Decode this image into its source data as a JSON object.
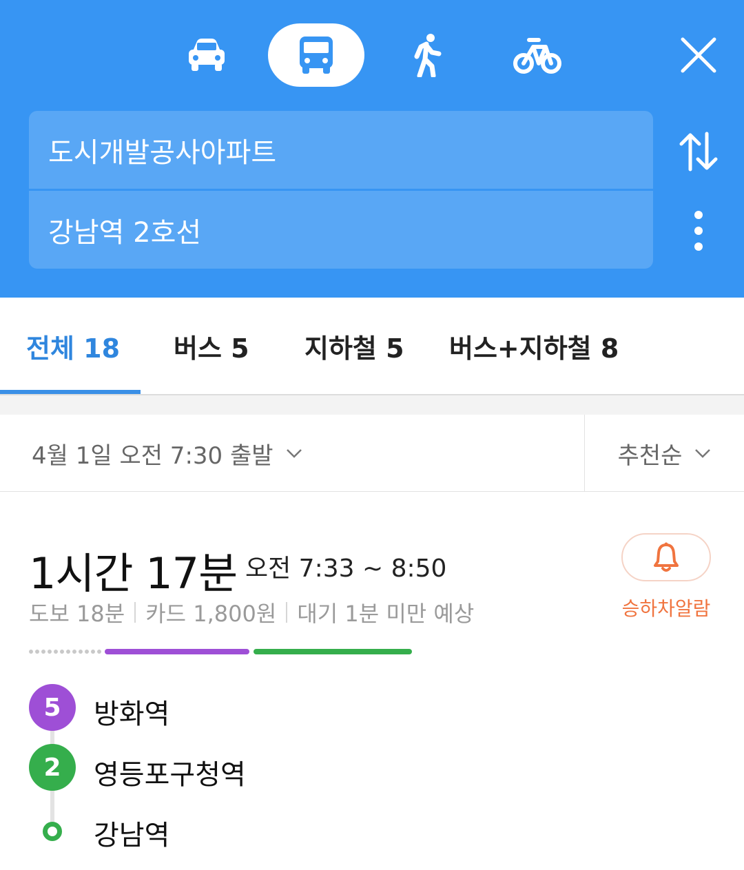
{
  "header": {
    "modes": [
      {
        "name": "car",
        "icon": "car-icon",
        "selected": false
      },
      {
        "name": "transit",
        "icon": "bus-icon",
        "selected": true
      },
      {
        "name": "walk",
        "icon": "walk-icon",
        "selected": false
      },
      {
        "name": "bike",
        "icon": "bike-icon",
        "selected": false
      }
    ],
    "close_icon": "close-icon",
    "origin": "도시개발공사아파트",
    "destination": "강남역 2호선",
    "swap_icon": "swap-icon",
    "more_icon": "more-vertical-icon",
    "background_color": "#3795f3"
  },
  "tabs": [
    {
      "label": "전체 18",
      "active": true
    },
    {
      "label": "버스 5",
      "active": false
    },
    {
      "label": "지하철 5",
      "active": false
    },
    {
      "label": "버스+지하철 8",
      "active": false
    }
  ],
  "filter": {
    "departure": "4월 1일 오전 7:30 출발",
    "sort": "추천순"
  },
  "route": {
    "duration": "1시간 17분",
    "time_range": "오전 7:33 ~ 8:50",
    "meta": [
      "도보 18분",
      "카드 1,800원",
      "대기 1분 미만 예상"
    ],
    "alarm_label": "승하차알람",
    "alarm_icon": "bell-icon",
    "segments": [
      {
        "type": "walk",
        "color": "#c9c9c9"
      },
      {
        "type": "line 5",
        "color": "#9e4fd6"
      },
      {
        "type": "line 2",
        "color": "#35ae4c"
      }
    ],
    "stops": [
      {
        "line": "5",
        "name": "방화역",
        "color": "#9e4fd6"
      },
      {
        "line": "2",
        "name": "영등포구청역",
        "color": "#35ae4c"
      },
      {
        "line": "",
        "name": "강남역",
        "color": "#35ae4c"
      }
    ]
  },
  "colors": {
    "accent": "#2f86de",
    "alarm": "#f0743f",
    "line5": "#9e4fd6",
    "line2": "#35ae4c"
  }
}
